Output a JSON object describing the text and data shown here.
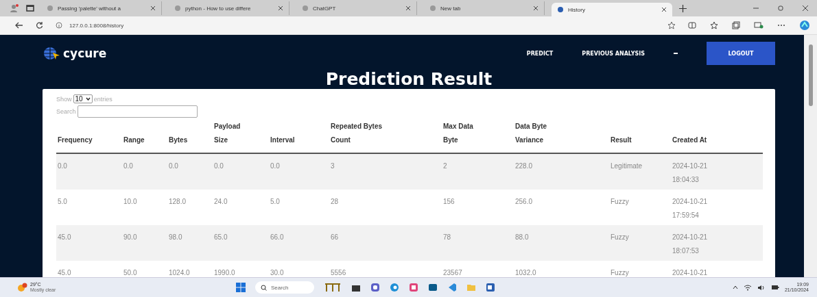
{
  "browser": {
    "tabs": [
      {
        "title": "Passing 'palette' without a",
        "selected": false
      },
      {
        "title": "python - How to use differe",
        "selected": false
      },
      {
        "title": "ChatGPT",
        "selected": false
      },
      {
        "title": "New tab",
        "selected": false
      },
      {
        "title": "History",
        "selected": true
      }
    ],
    "address": "127.0.0.1:8008/history"
  },
  "navbar": {
    "brand": "cycure",
    "links": [
      "PREDICT",
      "PREVIOUS ANALYSIS"
    ],
    "logout": "LOGOUT"
  },
  "title": "Prediction Result",
  "table_controls": {
    "show_label": "Show",
    "page_size": "10",
    "entries_label": "entries",
    "search_label": "Search"
  },
  "table": {
    "columns": [
      "Frequency",
      "Range",
      "Bytes",
      "Payload Size",
      "Interval",
      "Repeated Bytes Count",
      "Max Data Byte",
      "Data Byte Variance",
      "Result",
      "Created At"
    ],
    "rows": [
      {
        "cells": [
          "0.0",
          "0.0",
          "0.0",
          "0.0",
          "0.0",
          "3",
          "2",
          "228.0",
          "Legitimate",
          "2024-10-21 18:04:33"
        ]
      },
      {
        "cells": [
          "5.0",
          "10.0",
          "128.0",
          "24.0",
          "5.0",
          "28",
          "156",
          "256.0",
          "Fuzzy",
          "2024-10-21 17:59:54"
        ]
      },
      {
        "cells": [
          "45.0",
          "90.0",
          "98.0",
          "65.0",
          "66.0",
          "66",
          "78",
          "88.0",
          "Fuzzy",
          "2024-10-21 18:07:53"
        ]
      },
      {
        "cells": [
          "45.0",
          "50.0",
          "1024.0",
          "1990.0",
          "30.0",
          "5556",
          "23567",
          "1032.0",
          "Fuzzy",
          "2024-10-21"
        ]
      }
    ]
  },
  "taskbar": {
    "temperature": "29°C",
    "weather": "Mostly clear",
    "search_placeholder": "Search",
    "time": "19:09",
    "date": "21/10/2024"
  }
}
